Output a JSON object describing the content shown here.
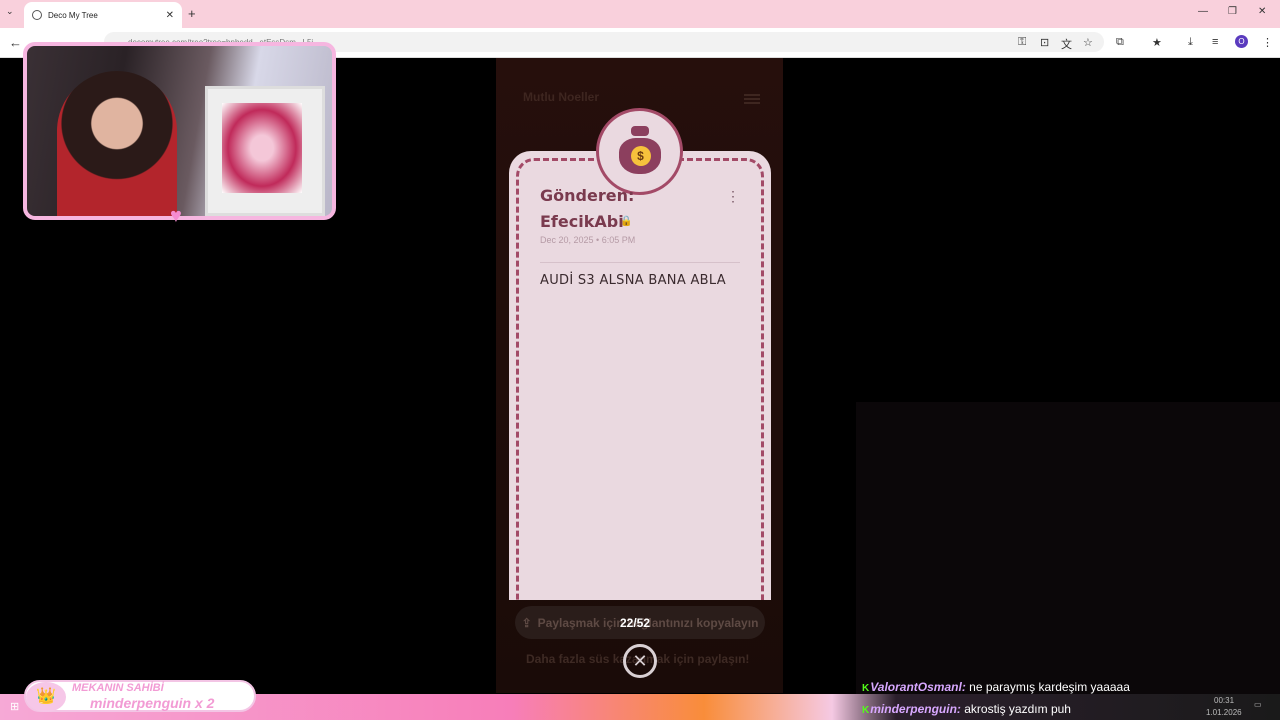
{
  "browser": {
    "tab_title": "Deco My Tree",
    "tab_close": "✕",
    "new_tab": "+",
    "tab_list": "⌄",
    "url": "decomytree.com/tree?tree=bnbedd...etEssDsm...L5j",
    "win_min": "—",
    "win_max": "❐",
    "win_close": "✕",
    "profile_initial": "O"
  },
  "page": {
    "title": "Mutlu Noeller",
    "sender_label": "Gönderen:",
    "sender_name": "EfecikAbi",
    "date": "Dec 20, 2025 • 6:05 PM",
    "message": "AUDİ S3 ALSNA BANA ABLA",
    "coin_symbol": "$",
    "share_button": "Paylaşmak için bağlantınızı kopyalayın",
    "counter": "22/52",
    "share_hint": "Daha fazla süs kazanmak için paylaşın!"
  },
  "overlay": {
    "banner_title": "MEKANIN SAHİBİ",
    "banner_user": "minderpenguin x 2"
  },
  "chat": [
    {
      "user": "ValorantOsmanl:",
      "text": "ne paraymış kardeşim yaaaaa"
    },
    {
      "user": "minderpenguin:",
      "text": "akrostiş yazdım puh"
    }
  ],
  "taskbar": {
    "time": "00:31",
    "date": "1.01.2026"
  },
  "colors": {
    "accent": "#a34a67",
    "card": "#ead9e0",
    "chrome_tabbar": "#f9d0dc"
  }
}
